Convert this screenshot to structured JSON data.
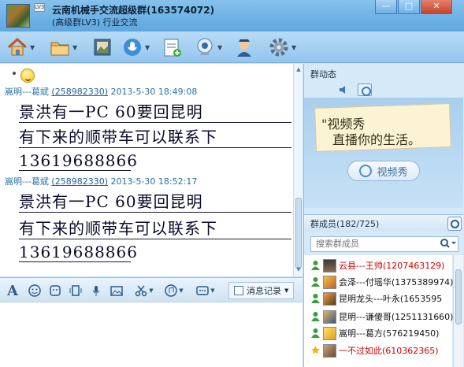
{
  "window": {
    "title": "云南机械手交流超级群(163574072)",
    "subtitle": "(高级群LV3) 行业交流",
    "badge": "LV3",
    "controls": [
      "minimize",
      "maximize",
      "close"
    ]
  },
  "toolbar": {
    "icons": [
      "home-icon",
      "folder-icon",
      "photo-album-icon",
      "voice-icon",
      "notes-icon",
      "webcam-icon",
      "admin-icon",
      "settings-icon"
    ]
  },
  "chat": {
    "messages": [
      {
        "sender": "嵩明---葛斌",
        "uid": "(258982330)",
        "timestamp": "2013-5-30  18:49:08",
        "lines": [
          "景洪有一PC   60要回昆明",
          "有下来的顺带车可以联系下",
          "13619688866"
        ]
      },
      {
        "sender": "嵩明---葛斌",
        "uid": "(258982330)",
        "timestamp": "2013-5-30  18:52:17",
        "lines": [
          "景洪有一PC   60要回昆明",
          "有下来的顺带车可以联系下",
          "13619688866"
        ]
      }
    ]
  },
  "input_toolbar": {
    "history_label": "消息记录"
  },
  "group_news": {
    "title": "群动态",
    "note_lines": [
      "\"视频秀",
      "直播你的生活。"
    ],
    "video_button": "视频秀"
  },
  "members": {
    "title": "群成员(182/725)",
    "search_placeholder": "搜索群成员",
    "list": [
      {
        "name": "云县---王帅(1207463129)",
        "color": "#d40000"
      },
      {
        "name": "会泽---付瑶华(1375389974)",
        "color": "#111111"
      },
      {
        "name": "昆明龙头---叶永(1653595",
        "color": "#111111"
      },
      {
        "name": "昆明---谦傻哥(1251131660)",
        "color": "#111111"
      },
      {
        "name": "嵩明---葛方(576219450)",
        "color": "#111111"
      },
      {
        "name": "一不过如此(610362365)",
        "color": "#d40000"
      }
    ]
  },
  "colors": {
    "accent": "#5ea7e0",
    "header_text": "#2a6fa8",
    "admin_red": "#d40000"
  }
}
